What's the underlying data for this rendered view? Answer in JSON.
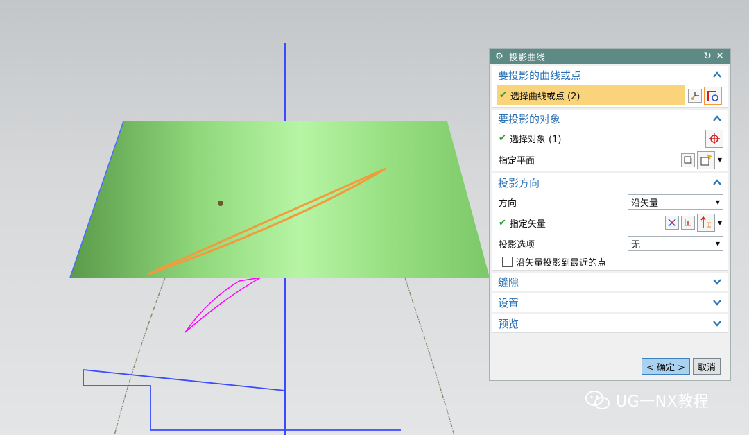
{
  "dialog": {
    "title": "投影曲线",
    "groups": {
      "curves": {
        "header": "要投影的曲线或点",
        "select_label": "选择曲线或点 (2)"
      },
      "objects": {
        "header": "要投影的对象",
        "select_label": "选择对象 (1)",
        "plane_label": "指定平面"
      },
      "direction": {
        "header": "投影方向",
        "direction_label": "方向",
        "direction_value": "沿矢量",
        "vector_label": "指定矢量",
        "option_label": "投影选项",
        "option_value": "无",
        "checkbox_label": "沿矢量投影到最近的点"
      },
      "gap": {
        "header": "缝隙"
      },
      "settings": {
        "header": "设置"
      },
      "preview": {
        "header": "预览"
      }
    },
    "ok_label": "< 确定 >",
    "cancel_label": "取消"
  },
  "watermark": "UG一NX教程",
  "colors": {
    "title_bar": "#5d8a85",
    "group_header_text": "#2a72b5",
    "selection_highlight": "#f9d47a",
    "surface_green": "#8fd77a",
    "curve_orange": "#f39a3c",
    "curve_magenta": "#ff00ff",
    "wire_blue": "#3a4bff"
  }
}
